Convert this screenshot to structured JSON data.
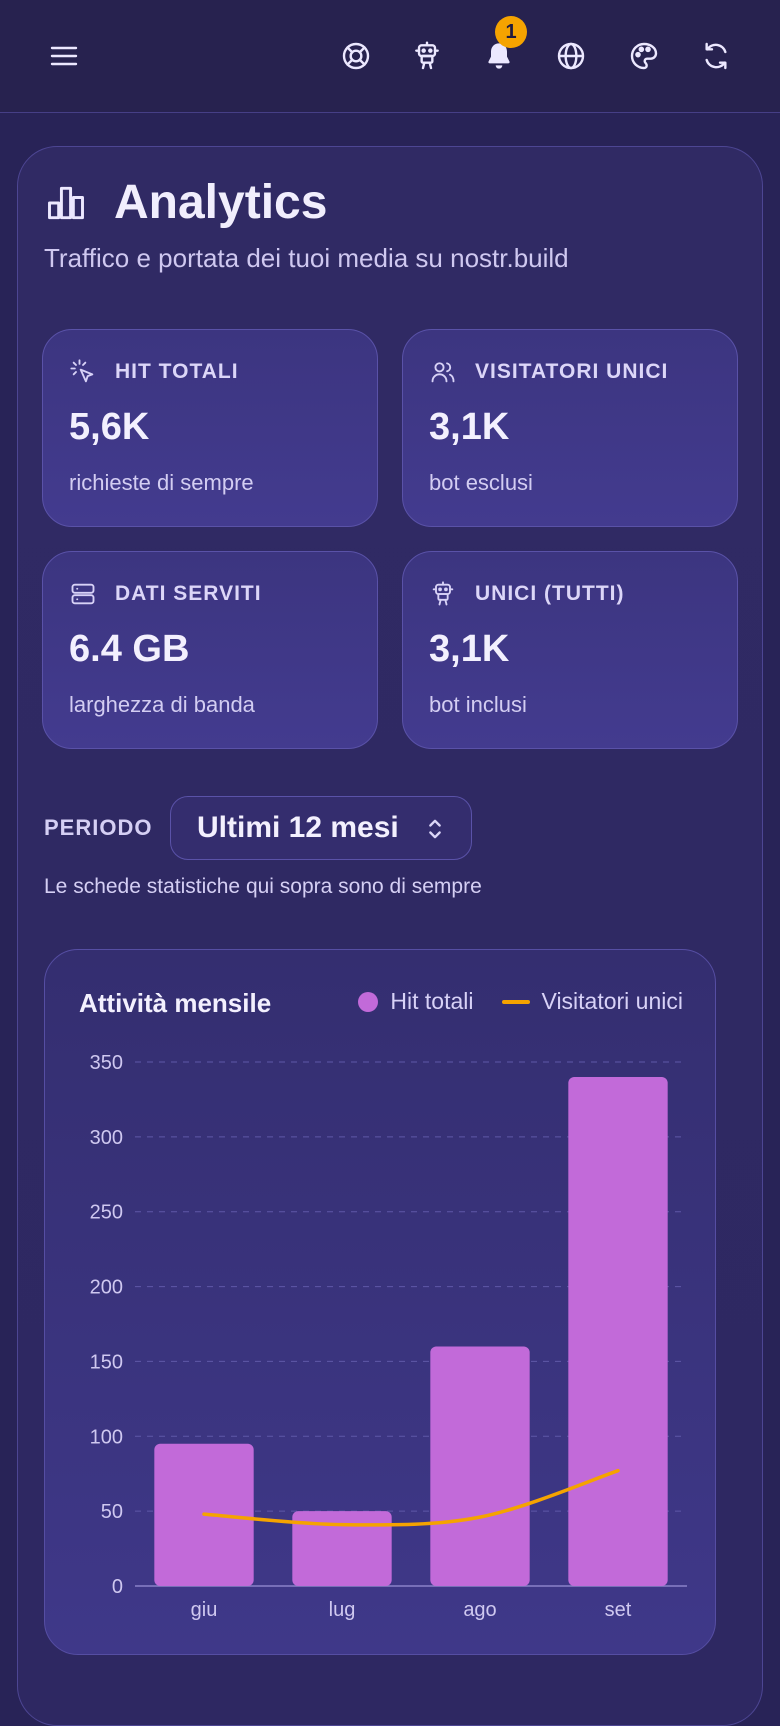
{
  "colors": {
    "background": "#282357",
    "card": "#3c3580",
    "bar": "#c26ad9",
    "line": "#f5a300",
    "badge": "#f5a300"
  },
  "topbar": {
    "menu_icon": "menu-icon",
    "icons": [
      "lifebuoy-icon",
      "robot-icon",
      "bell-icon",
      "globe-icon",
      "palette-icon",
      "refresh-icon"
    ],
    "notification_count": "1"
  },
  "page": {
    "title": "Analytics",
    "subtitle": "Traffico e portata dei tuoi media su nostr.build"
  },
  "stats": [
    {
      "icon": "cursor-click-icon",
      "label": "HIT TOTALI",
      "value": "5,6K",
      "desc": "richieste di sempre"
    },
    {
      "icon": "users-icon",
      "label": "VISITATORI UNICI",
      "value": "3,1K",
      "desc": "bot esclusi"
    },
    {
      "icon": "server-icon",
      "label": "DATI SERVITI",
      "value": "6.4 GB",
      "desc": "larghezza di banda"
    },
    {
      "icon": "robot-icon",
      "label": "UNICI (TUTTI)",
      "value": "3,1K",
      "desc": "bot inclusi"
    }
  ],
  "period": {
    "label": "PERIODO",
    "selected": "Ultimi 12 mesi",
    "note": "Le schede statistiche qui sopra sono di sempre"
  },
  "chart_data": {
    "type": "bar",
    "title": "Attività mensile",
    "categories": [
      "giu",
      "lug",
      "ago",
      "set"
    ],
    "series": [
      {
        "name": "Hit totali",
        "kind": "bar",
        "color": "#c26ad9",
        "values": [
          95,
          50,
          160,
          340
        ]
      },
      {
        "name": "Visitatori unici",
        "kind": "line",
        "color": "#f5a300",
        "values": [
          48,
          41,
          46,
          77
        ]
      }
    ],
    "ylim": [
      0,
      350
    ],
    "yticks": [
      0,
      50,
      100,
      150,
      200,
      250,
      300,
      350
    ],
    "grid": true,
    "legend": "top-right",
    "xlabel": "",
    "ylabel": ""
  }
}
